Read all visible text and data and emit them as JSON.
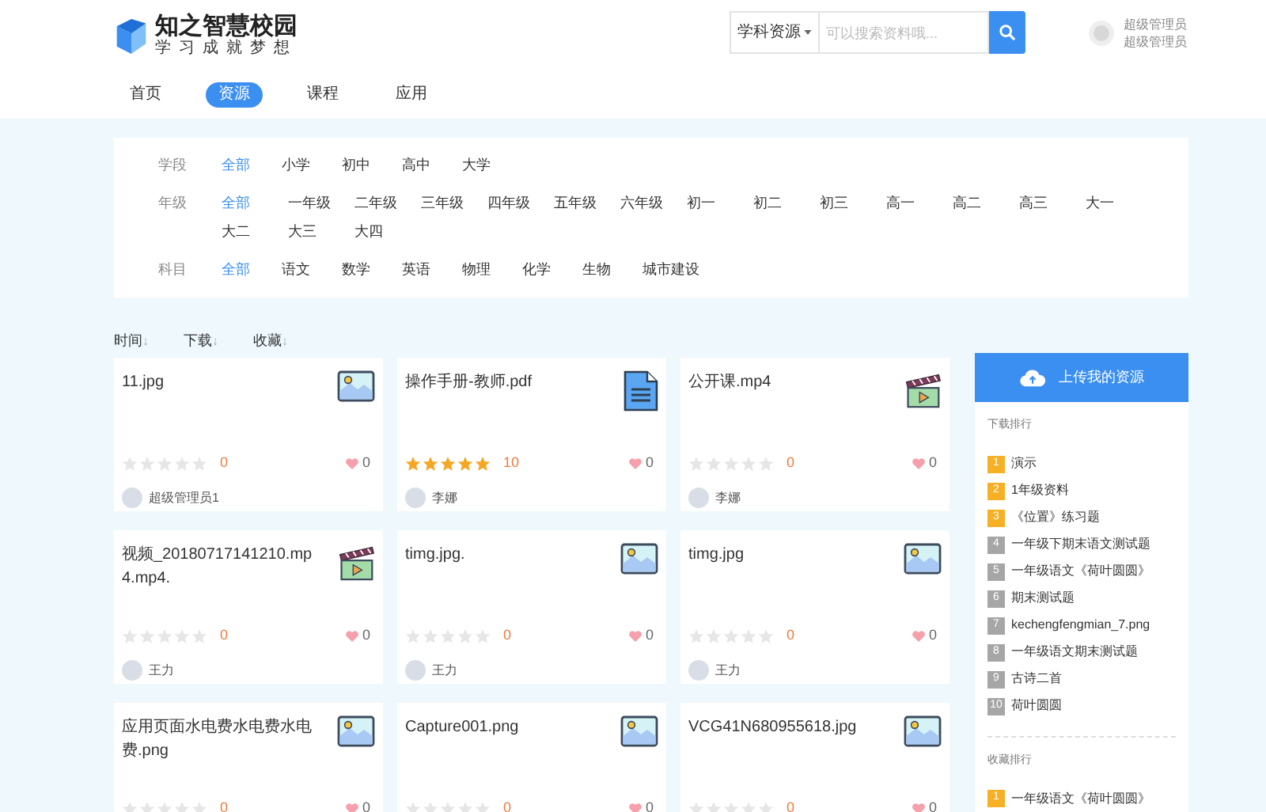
{
  "header": {
    "logo_title": "知之智慧校园",
    "logo_subtitle": "学习成就梦想",
    "search": {
      "category": "学科资源",
      "placeholder": "可以搜索资料哦..."
    },
    "user": {
      "name": "超级管理员",
      "role": "超级管理员"
    }
  },
  "nav": [
    {
      "label": "首页",
      "selected": false
    },
    {
      "label": "资源",
      "selected": true
    },
    {
      "label": "课程",
      "selected": false
    },
    {
      "label": "应用",
      "selected": false
    }
  ],
  "filters": [
    {
      "label": "学段",
      "options": [
        {
          "label": "全部",
          "selected": true
        },
        {
          "label": "小学",
          "selected": false
        },
        {
          "label": "初中",
          "selected": false
        },
        {
          "label": "高中",
          "selected": false
        },
        {
          "label": "大学",
          "selected": false
        }
      ]
    },
    {
      "label": "年级",
      "options": [
        {
          "label": "全部",
          "selected": true
        },
        {
          "label": "一年级",
          "selected": false
        },
        {
          "label": "二年级",
          "selected": false
        },
        {
          "label": "三年级",
          "selected": false
        },
        {
          "label": "四年级",
          "selected": false
        },
        {
          "label": "五年级",
          "selected": false
        },
        {
          "label": "六年级",
          "selected": false
        },
        {
          "label": "初一",
          "selected": false
        },
        {
          "label": "初二",
          "selected": false
        },
        {
          "label": "初三",
          "selected": false
        },
        {
          "label": "高一",
          "selected": false
        },
        {
          "label": "高二",
          "selected": false
        },
        {
          "label": "高三",
          "selected": false
        },
        {
          "label": "大一",
          "selected": false
        },
        {
          "label": "大二",
          "selected": false
        },
        {
          "label": "大三",
          "selected": false
        },
        {
          "label": "大四",
          "selected": false
        }
      ]
    },
    {
      "label": "科目",
      "options": [
        {
          "label": "全部",
          "selected": true
        },
        {
          "label": "语文",
          "selected": false
        },
        {
          "label": "数学",
          "selected": false
        },
        {
          "label": "英语",
          "selected": false
        },
        {
          "label": "物理",
          "selected": false
        },
        {
          "label": "化学",
          "selected": false
        },
        {
          "label": "生物",
          "selected": false
        },
        {
          "label": "城市建设",
          "selected": false
        }
      ]
    }
  ],
  "sort": [
    {
      "label": "时间",
      "arrow": "↓"
    },
    {
      "label": "下载",
      "arrow": "↓"
    },
    {
      "label": "收藏",
      "arrow": "↓"
    }
  ],
  "resources": [
    {
      "name": "11.jpg",
      "kind": "image",
      "stars": 0,
      "rating": "0",
      "likes": "0",
      "user": "超级管理员1"
    },
    {
      "name": "操作手册-教师.pdf",
      "kind": "document",
      "stars": 5,
      "rating": "10",
      "likes": "0",
      "user": "李娜"
    },
    {
      "name": "公开课.mp4",
      "kind": "video",
      "stars": 0,
      "rating": "0",
      "likes": "0",
      "user": "李娜"
    },
    {
      "name": "视频_20180717141210.mp4.mp4.",
      "kind": "video",
      "stars": 0,
      "rating": "0",
      "likes": "0",
      "user": "王力"
    },
    {
      "name": "timg.jpg.",
      "kind": "image",
      "stars": 0,
      "rating": "0",
      "likes": "0",
      "user": "王力"
    },
    {
      "name": "timg.jpg",
      "kind": "image",
      "stars": 0,
      "rating": "0",
      "likes": "0",
      "user": "王力"
    },
    {
      "name": "应用页面水电费水电费水电费.png",
      "kind": "image",
      "stars": 0,
      "rating": "0",
      "likes": "0"
    },
    {
      "name": "Capture001.png",
      "kind": "image",
      "stars": 0,
      "rating": "0",
      "likes": "0"
    },
    {
      "name": "VCG41N680955618.jpg",
      "kind": "image",
      "stars": 0,
      "rating": "0",
      "likes": "0"
    }
  ],
  "sidebar": {
    "upload_button": "上传我的资源",
    "download_ranking": {
      "title": "下载排行",
      "items": [
        {
          "rank": "1",
          "title": "演示",
          "color": "#f5b025"
        },
        {
          "rank": "2",
          "title": "1年级资料",
          "color": "#f5b025"
        },
        {
          "rank": "3",
          "title": "《位置》练习题",
          "color": "#f5b025"
        },
        {
          "rank": "4",
          "title": "一年级下期末语文测试题",
          "color": "#a6a6a6"
        },
        {
          "rank": "5",
          "title": "一年级语文《荷叶圆圆》",
          "color": "#a6a6a6"
        },
        {
          "rank": "6",
          "title": "期末测试题",
          "color": "#a6a6a6"
        },
        {
          "rank": "7",
          "title": "kechengfengmian_7.png",
          "color": "#a6a6a6"
        },
        {
          "rank": "8",
          "title": "一年级语文期末测试题",
          "color": "#a6a6a6"
        },
        {
          "rank": "9",
          "title": "古诗二首",
          "color": "#a6a6a6"
        },
        {
          "rank": "10",
          "title": "荷叶圆圆",
          "color": "#a6a6a6"
        }
      ]
    },
    "favorite_ranking": {
      "title": "收藏排行",
      "items": [
        {
          "rank": "1",
          "title": "一年级语文《荷叶圆圆》",
          "color": "#f5b025"
        }
      ]
    }
  }
}
